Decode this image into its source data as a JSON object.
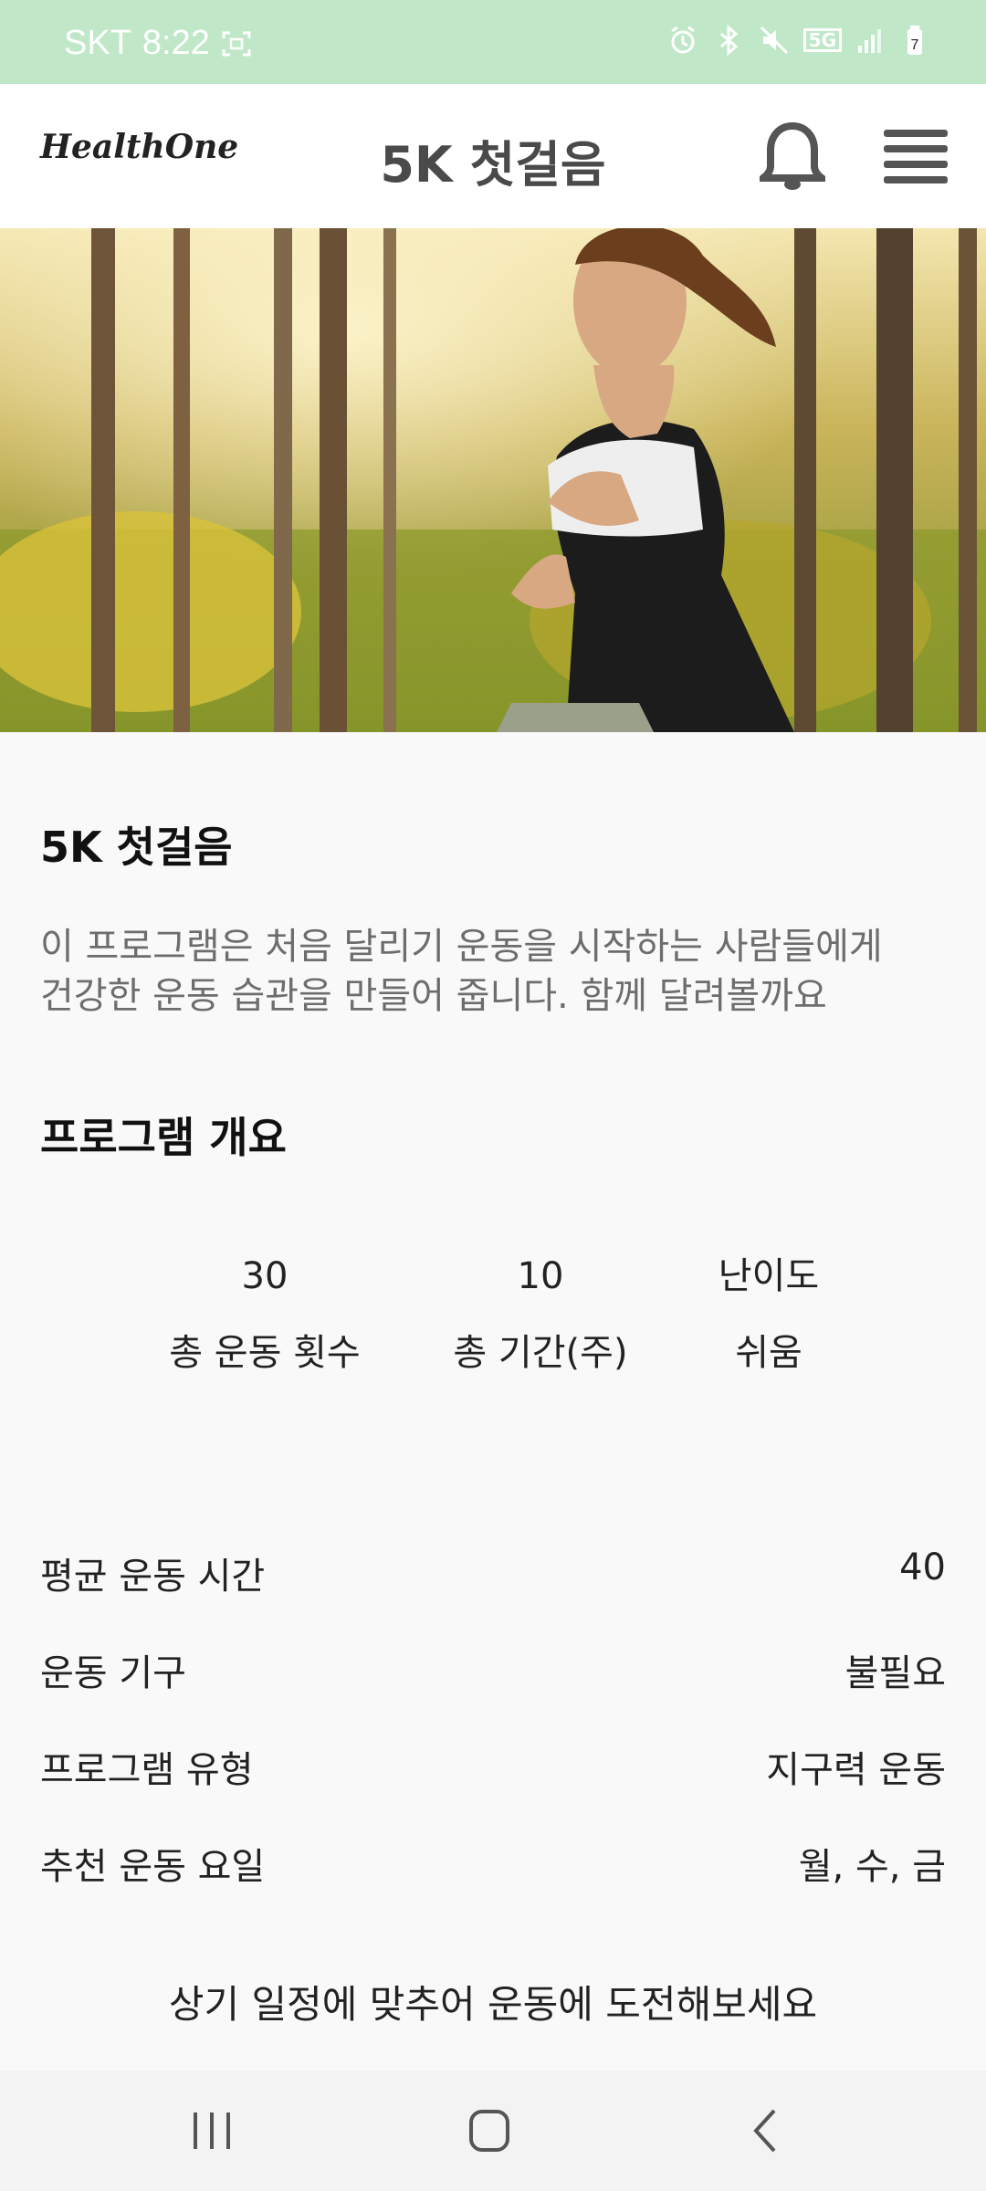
{
  "status_bar": {
    "carrier": "SKT",
    "time": "8:22",
    "network": "5G",
    "battery": "7"
  },
  "header": {
    "logo_text": "HealthOne",
    "title": "5K 첫걸음"
  },
  "program": {
    "title": "5K 첫걸음",
    "description_line1": "이 프로그램은 처음 달리기 운동을 시작하는 사람들에게",
    "description_line2": "건강한 운동 습관을 만들어 줍니다. 함께 달려볼까요"
  },
  "overview": {
    "heading": "프로그램 개요",
    "stats": [
      {
        "value": "30",
        "label": "총 운동 횟수"
      },
      {
        "value": "10",
        "label": "총 기간(주)"
      },
      {
        "value": "난이도",
        "label": "쉬움"
      }
    ]
  },
  "details": [
    {
      "key": "평균 운동 시간",
      "value": "40"
    },
    {
      "key": "운동 기구",
      "value": "불필요"
    },
    {
      "key": "프로그램 유형",
      "value": "지구력 운동"
    },
    {
      "key": "추천 운동 요일",
      "value": "월, 수, 금"
    }
  ],
  "footer_message": "상기 일정에 맞추어 운동에 도전해보세요",
  "colors": {
    "status_bar": "#c0e8c8",
    "header_title": "#4a4a4a",
    "description": "#6d6d6d",
    "background": "#f9f9fa"
  },
  "icons": {
    "notification": "bell-icon",
    "menu": "hamburger-menu-icon",
    "nav_recents": "recents-icon",
    "nav_home": "home-icon",
    "nav_back": "back-icon"
  }
}
